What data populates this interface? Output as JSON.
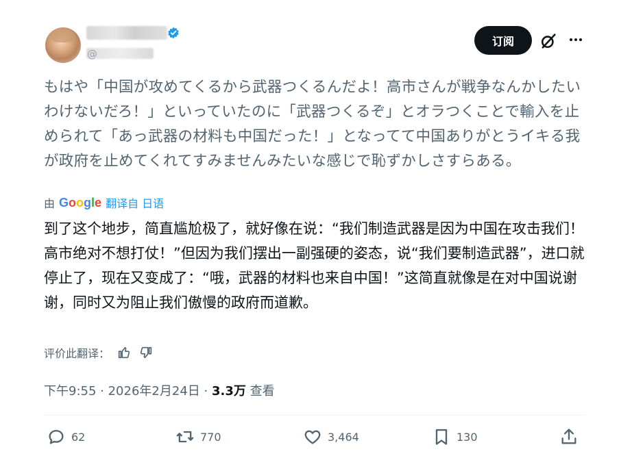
{
  "header": {
    "handle_prefix": "@",
    "subscribe_label": "订阅"
  },
  "icons": {
    "verified": "verified-badge-icon",
    "grok": "grok-icon",
    "more": "more-icon",
    "reply": "reply-icon",
    "repost": "repost-icon",
    "like": "like-icon",
    "bookmark": "bookmark-icon",
    "share": "share-icon",
    "thumb_up": "thumbs-up-icon",
    "thumb_down": "thumbs-down-icon"
  },
  "post": {
    "original_text": "もはや「中国が攻めてくるから武器つくるんだよ！高市さんが戦争なんかしたいわけないだろ！」といっていたのに「武器つくるぞ」とオラつくことで輸入を止められて「あっ武器の材料も中国だった！」となってて中国ありがとうイキる我が政府を止めてくれてすみませんみたいな感じで恥ずかしさすらある。",
    "translated_by_prefix": "由",
    "translated_by_brand": "Google",
    "translated_from": "翻译自 日语",
    "translated_text": "到了这个地步，简直尴尬极了，就好像在说：“我们制造武器是因为中国在攻击我们！高市绝对不想打仗！”但因为我们摆出一副强硬的姿态，说“我们要制造武器”，进口就停止了，现在又变成了：“哦，武器的材料也来自中国！”这简直就像是在对中国说谢谢，同时又为阻止我们傲慢的政府而道歉。",
    "rate_label": "评价此翻译：",
    "time": "下午9:55",
    "date": "2026年2月24日",
    "views_count": "3.3万",
    "views_label": "查看"
  },
  "actions": {
    "replies": "62",
    "reposts": "770",
    "likes": "3,464",
    "bookmarks": "130"
  },
  "colors": {
    "text_primary": "#0f1419",
    "text_secondary": "#536471",
    "link": "#1d9bf0",
    "button_bg": "#0f1419",
    "verified": "#1d9bf0"
  }
}
